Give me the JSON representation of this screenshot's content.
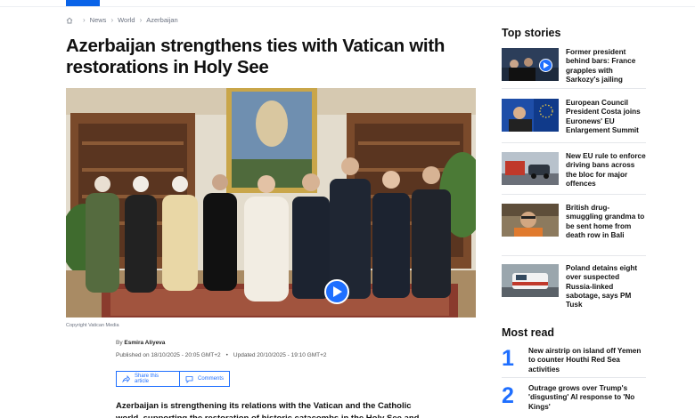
{
  "breadcrumb": {
    "items": [
      "News",
      "World",
      "Azerbaijan"
    ]
  },
  "article": {
    "title": "Azerbaijan strengthens ties with Vatican with restorations in Holy See",
    "image_caption": "Copyright Vatican Media",
    "byline_prefix": "By",
    "author": "Esmira Aliyeva",
    "published": "Published on 18/10/2025 - 20:05 GMT+2",
    "bullet": "•",
    "updated": "Updated 20/10/2025 - 19:10 GMT+2",
    "share_label": "Share this article",
    "comments_label": "Comments",
    "lead": "Azerbaijan is strengthening its relations with the Vatican and the Catholic world, supporting the restoration of historic catacombs in the Holy See and"
  },
  "sidebar": {
    "top_stories_heading": "Top stories",
    "top_stories": [
      {
        "title": "Former president behind bars: France grapples with Sarkozy's jailing",
        "has_video": true
      },
      {
        "title": "European Council President Costa joins Euronews' EU Enlargement Summit",
        "has_video": false
      },
      {
        "title": "New EU rule to enforce driving bans across the bloc for major offences",
        "has_video": false
      },
      {
        "title": "British drug-smuggling grandma to be sent home from death row in Bali",
        "has_video": false
      },
      {
        "title": "Poland detains eight over suspected Russia-linked sabotage, says PM Tusk",
        "has_video": false
      }
    ],
    "most_read_heading": "Most read",
    "most_read": [
      {
        "rank": "1",
        "title": "New airstrip on island off Yemen to counter Houthi Red Sea activities"
      },
      {
        "rank": "2",
        "title": "Outrage grows over Trump's 'disgusting' AI response to 'No Kings'"
      }
    ]
  },
  "colors": {
    "accent": "#1f6fff",
    "brand_bar": "#0a63e8"
  },
  "icons": [
    "home-icon",
    "chevron-right-icon",
    "share-icon",
    "comment-icon",
    "play-icon"
  ]
}
